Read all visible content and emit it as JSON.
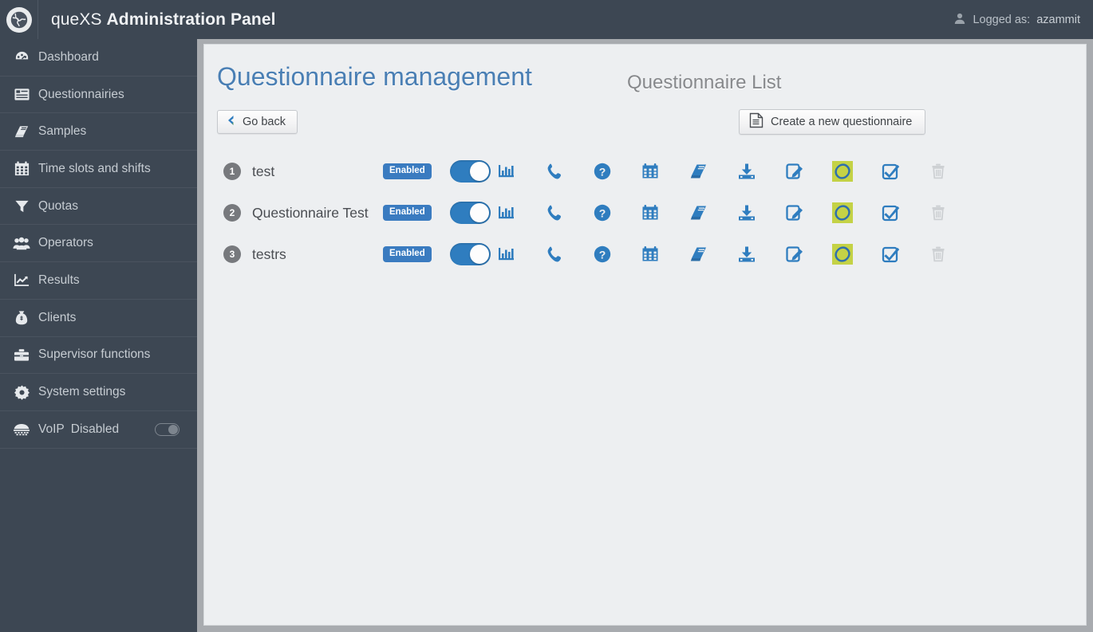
{
  "header": {
    "brand_light": "queXS",
    "brand_bold": "Administration Panel",
    "logo_icon": "globe-icon",
    "user_icon": "user-icon",
    "logged_label": "Logged as:",
    "username": "azammit"
  },
  "sidebar": {
    "items": [
      {
        "label": "Dashboard",
        "icon": "dashboard-icon"
      },
      {
        "label": "Questionnairies",
        "icon": "list-icon"
      },
      {
        "label": "Samples",
        "icon": "book-icon"
      },
      {
        "label": "Time slots and shifts",
        "icon": "calendar-icon"
      },
      {
        "label": "Quotas",
        "icon": "funnel-icon"
      },
      {
        "label": "Operators",
        "icon": "people-icon"
      },
      {
        "label": "Results",
        "icon": "line-chart-icon"
      },
      {
        "label": "Clients",
        "icon": "money-bag-icon"
      },
      {
        "label": "Supervisor functions",
        "icon": "briefcase-icon"
      },
      {
        "label": "System settings",
        "icon": "gear-icon"
      }
    ],
    "voip": {
      "label": "VoIP",
      "status": "Disabled",
      "icon": "telephone-icon",
      "toggle_state": "off"
    }
  },
  "main": {
    "page_title": "Questionnaire management",
    "list_title": "Questionnaire List",
    "go_back_label": "Go back",
    "go_back_icon": "chevron-left-icon",
    "create_label": "Create a new questionnaire",
    "create_icon": "document-icon",
    "action_icons": [
      "bar-chart-icon",
      "phone-icon",
      "question-mark-icon",
      "calendar-icon",
      "book-icon",
      "download-icon",
      "edit-icon",
      "limesurvey-icon",
      "checkbox-icon",
      "trash-icon"
    ],
    "rows": [
      {
        "number": "1",
        "name": "test",
        "status": "Enabled",
        "toggle_state": "on"
      },
      {
        "number": "2",
        "name": "Questionnaire Test",
        "status": "Enabled",
        "toggle_state": "on"
      },
      {
        "number": "3",
        "name": "testrs",
        "status": "Enabled",
        "toggle_state": "on"
      }
    ]
  },
  "colors": {
    "topbar": "#3d4753",
    "sidebar": "#3d4753",
    "accent_blue": "#2f7dbf",
    "title_blue": "#4a7fb4",
    "badge_blue": "#3a7bc0",
    "lime": "#c4d246",
    "content_bg": "#edeff1",
    "frame_gray": "#a8abaf"
  }
}
